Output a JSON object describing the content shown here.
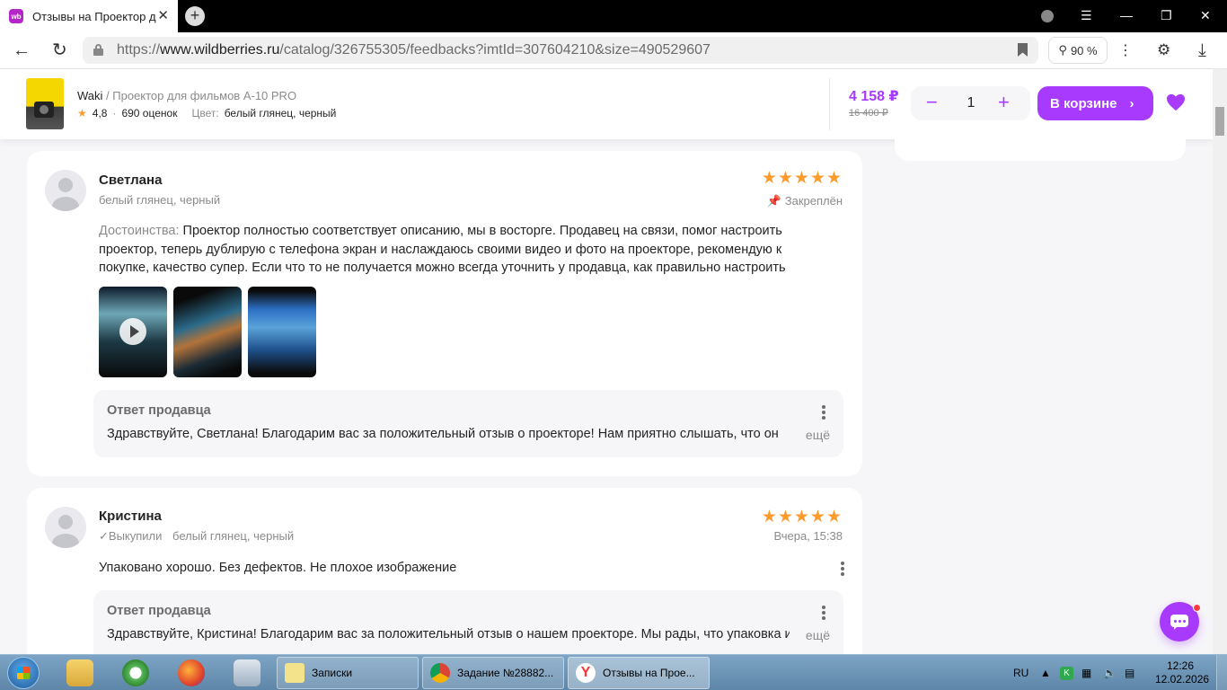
{
  "browser": {
    "tab_title": "Отзывы на Проектор д",
    "favicon_text": "wb",
    "url_prefix": "https://",
    "url_host": "www.wildberries.ru",
    "url_path": "/catalog/326755305/feedbacks?imtId=307604210&size=490529607",
    "zoom": "90 %"
  },
  "product": {
    "brand": "Waki",
    "name": " / Проектор для фильмов А-10 PRO",
    "rating": "4,8",
    "reviews_count": "690 оценок",
    "color_label": "Цвет:",
    "color_value": "белый глянец, черный",
    "price": "4 158 ₽",
    "old_price": "16 400 ₽",
    "quantity": "1",
    "cart_label": "В корзине"
  },
  "reviews": [
    {
      "author": "Светлана",
      "meta": "белый глянец, черный",
      "stars": "★★★★★",
      "right_label": "Закреплён",
      "pros_label": "Достоинства:",
      "text": "Проектор полностью соответствует описанию, мы в восторге. Продавец на связи, помог настроить проектор, теперь дублирую с телефона экран и наслаждаюсь своими видео и фото на проекторе, рекомендую к покупке, качество супер. Если что то не получается можно всегда уточнить у продавца, как правильно настроить",
      "seller_title": "Ответ продавца",
      "seller_text": "Здравствуйте, Светлана! Благодарим вас за положительный отзыв о проекторе! Нам приятно слышать, что он",
      "more": "ещё"
    },
    {
      "author": "Кристина",
      "bought": "Выкупили",
      "meta": "белый глянец, черный",
      "stars": "★★★★★",
      "date": "Вчера, 15:38",
      "text": "Упаковано хорошо. Без дефектов. Не плохое изображение",
      "seller_title": "Ответ продавца",
      "seller_text": "Здравствуйте, Кристина! Благодарим вас за положительный отзыв о нашем проекторе. Мы рады, что упаковка и",
      "more": "ещё"
    }
  ],
  "taskbar": {
    "tasks": [
      {
        "label": "Записки"
      },
      {
        "label": "Задание №28882..."
      },
      {
        "label": "Отзывы на Прое..."
      }
    ],
    "lang": "RU",
    "time": "12:26",
    "date": "12.02.2026"
  },
  "colors": {
    "accent": "#a73afd",
    "star": "#ff9b2b"
  }
}
